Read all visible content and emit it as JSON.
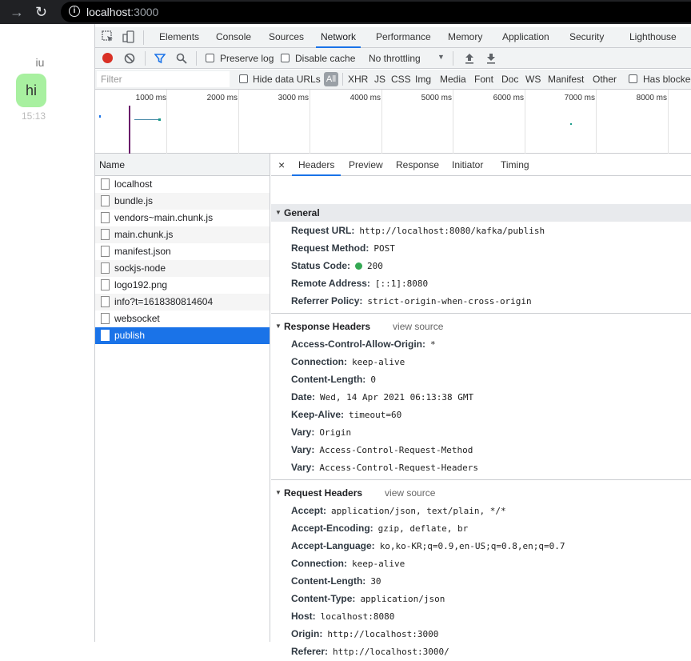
{
  "browser": {
    "host": "localhost",
    "port": ":3000"
  },
  "app": {
    "user": "iu",
    "message": "hi",
    "time": "15:13"
  },
  "devtools": {
    "tabs": [
      "Elements",
      "Console",
      "Sources",
      "Network",
      "Performance",
      "Memory",
      "Application",
      "Security",
      "Lighthouse"
    ],
    "active_tab": "Network",
    "toolbar": {
      "preserve_log": "Preserve log",
      "disable_cache": "Disable cache",
      "throttling": "No throttling"
    },
    "filter": {
      "placeholder": "Filter",
      "hide_data_urls": "Hide data URLs",
      "all": "All",
      "types": [
        "XHR",
        "JS",
        "CSS",
        "Img",
        "Media",
        "Font",
        "Doc",
        "WS",
        "Manifest",
        "Other"
      ],
      "has_blocked": "Has blocked cookies"
    },
    "timeline_ticks": [
      "1000 ms",
      "2000 ms",
      "3000 ms",
      "4000 ms",
      "5000 ms",
      "6000 ms",
      "7000 ms",
      "8000 ms"
    ],
    "name_header": "Name",
    "requests": [
      "localhost",
      "bundle.js",
      "vendors~main.chunk.js",
      "main.chunk.js",
      "manifest.json",
      "sockjs-node",
      "logo192.png",
      "info?t=1618380814604",
      "websocket",
      "publish"
    ],
    "selected_request": "publish",
    "detail_tabs": [
      "Headers",
      "Preview",
      "Response",
      "Initiator",
      "Timing"
    ],
    "close": "×",
    "general": {
      "title": "General",
      "rows": [
        {
          "k": "Request URL:",
          "v": "http://localhost:8080/kafka/publish"
        },
        {
          "k": "Request Method:",
          "v": "POST"
        },
        {
          "k": "Status Code:",
          "v": "200"
        },
        {
          "k": "Remote Address:",
          "v": "[::1]:8080"
        },
        {
          "k": "Referrer Policy:",
          "v": "strict-origin-when-cross-origin"
        }
      ]
    },
    "response_headers": {
      "title": "Response Headers",
      "view_source": "view source",
      "rows": [
        {
          "k": "Access-Control-Allow-Origin:",
          "v": "*"
        },
        {
          "k": "Connection:",
          "v": "keep-alive"
        },
        {
          "k": "Content-Length:",
          "v": "0"
        },
        {
          "k": "Date:",
          "v": "Wed, 14 Apr 2021 06:13:38 GMT"
        },
        {
          "k": "Keep-Alive:",
          "v": "timeout=60"
        },
        {
          "k": "Vary:",
          "v": "Origin"
        },
        {
          "k": "Vary:",
          "v": "Access-Control-Request-Method"
        },
        {
          "k": "Vary:",
          "v": "Access-Control-Request-Headers"
        }
      ]
    },
    "request_headers": {
      "title": "Request Headers",
      "view_source": "view source",
      "rows": [
        {
          "k": "Accept:",
          "v": "application/json, text/plain, */*"
        },
        {
          "k": "Accept-Encoding:",
          "v": "gzip, deflate, br"
        },
        {
          "k": "Accept-Language:",
          "v": "ko,ko-KR;q=0.9,en-US;q=0.8,en;q=0.7"
        },
        {
          "k": "Connection:",
          "v": "keep-alive"
        },
        {
          "k": "Content-Length:",
          "v": "30"
        },
        {
          "k": "Content-Type:",
          "v": "application/json"
        },
        {
          "k": "Host:",
          "v": "localhost:8080"
        },
        {
          "k": "Origin:",
          "v": "http://localhost:3000"
        },
        {
          "k": "Referer:",
          "v": "http://localhost:3000/"
        }
      ]
    }
  }
}
